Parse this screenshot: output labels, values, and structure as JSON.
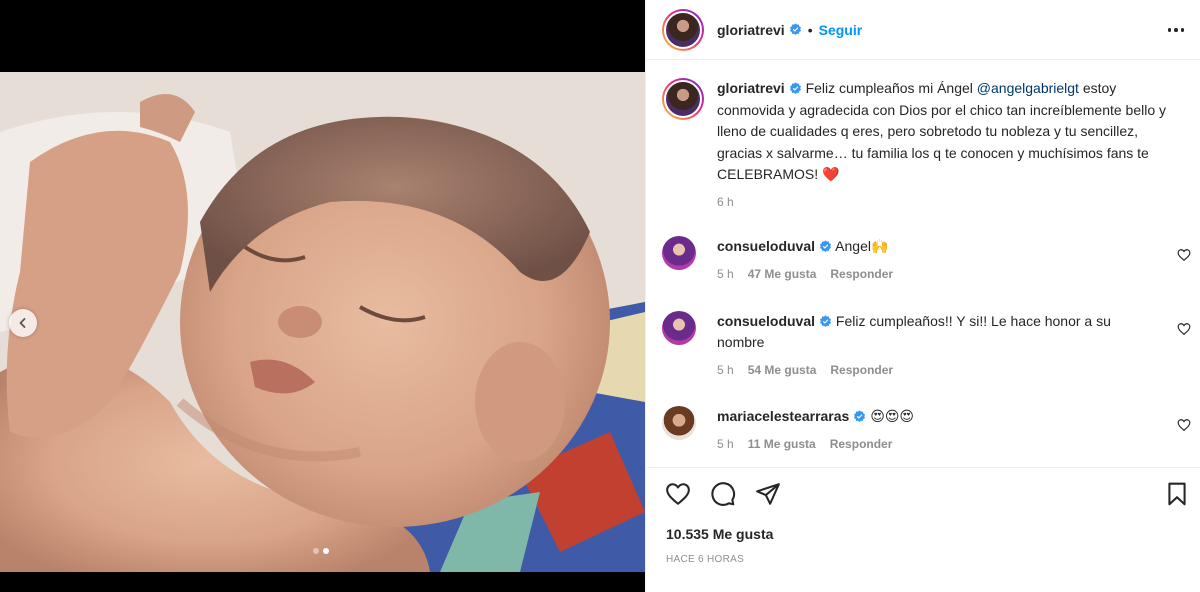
{
  "post": {
    "author": "gloriatrevi",
    "follow_label": "Seguir",
    "separator": "•",
    "caption_before": "Feliz cumpleaños mi Ángel ",
    "caption_mention": "@angelgabrielgt",
    "caption_after": " estoy conmovida y agradecida con Dios por el chico tan increíblemente bello y lleno de cualidades q eres, pero sobretodo tu nobleza y tu sencillez, gracias x salvarme… tu familia los q te conocen y muchísimos fans te CELEBRAMOS! ❤️",
    "caption_time": "6 h",
    "likes": "10.535 Me gusta",
    "posted_ago": "HACE 6 HORAS"
  },
  "media": {
    "slide_count": 2,
    "active_slide": 2
  },
  "comments": [
    {
      "user": "consueloduval",
      "text": "Angel🙌",
      "time": "5 h",
      "likes": "47 Me gusta",
      "reply": "Responder"
    },
    {
      "user": "consueloduval",
      "text": "Feliz cumpleaños!! Y si!! Le hace honor a su nombre",
      "time": "5 h",
      "likes": "54 Me gusta",
      "reply": "Responder"
    },
    {
      "user": "mariacelestearraras",
      "text": "😍😍😍",
      "time": "5 h",
      "likes": "11 Me gusta",
      "reply": "Responder"
    }
  ],
  "icons": {
    "verified": "verified-badge-icon",
    "like": "heart-icon",
    "comment": "comment-icon",
    "share": "paper-plane-icon",
    "save": "bookmark-icon",
    "more": "more-options-icon",
    "prev": "chevron-left-icon"
  },
  "colors": {
    "link_blue": "#0095f6",
    "mention": "#00376b",
    "verified": "#3897f0",
    "muted": "#8e8e8e",
    "text": "#262626"
  }
}
